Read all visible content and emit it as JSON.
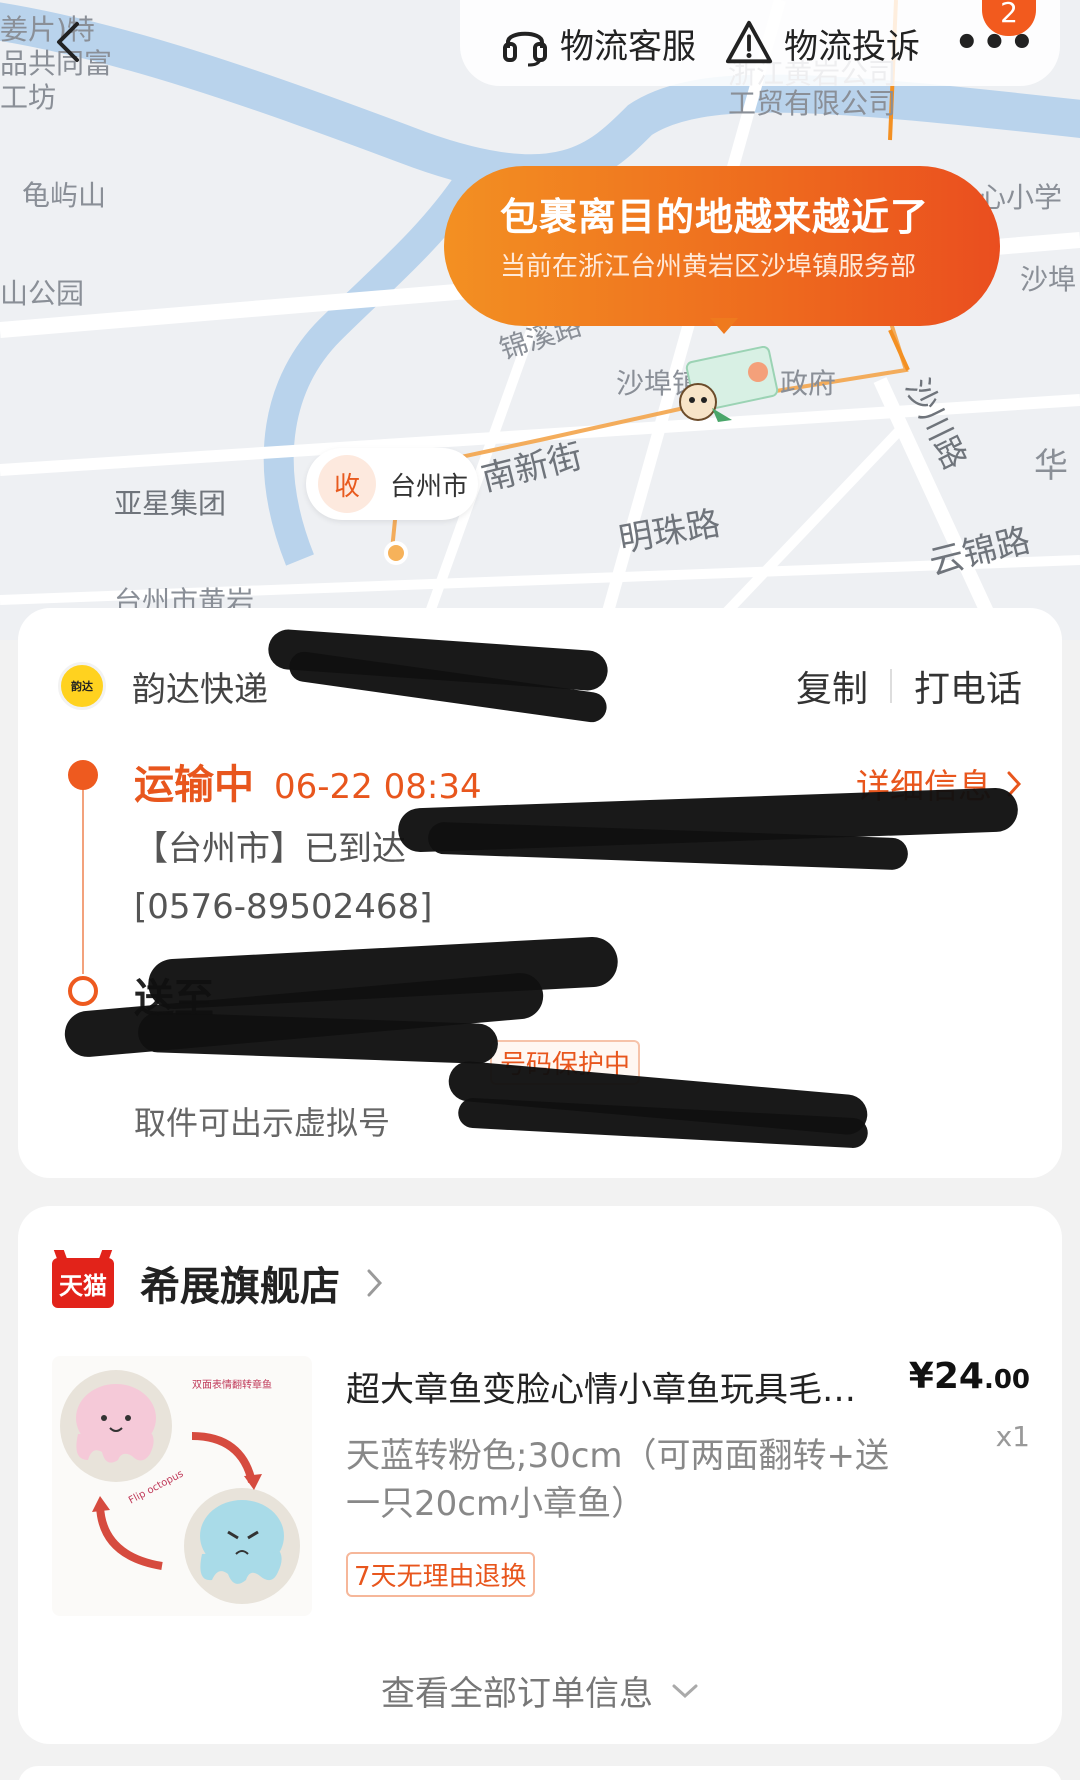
{
  "map": {
    "labels": [
      "姜片)特",
      "品共同富",
      "工坊",
      "龟屿山",
      "山公园",
      "锦溪路",
      "沙埠镇",
      "政府",
      "南新街",
      "明珠路",
      "亚星集团",
      "台州市黄岩",
      "云锦路",
      "沙川路",
      "心小学",
      "沙埠",
      "华",
      "浙江黄岩公司",
      "工贸有限公司"
    ],
    "bubble": {
      "title": "包裹离目的地越来越近了",
      "subtitle": "当前在浙江台州黄岩区沙埠镇服务部"
    },
    "receiver_tag": {
      "icon_text": "收",
      "city": "台州市"
    },
    "route_color": "#f39022"
  },
  "topbar": {
    "back_icon": "chevron-left-icon",
    "service_label": "物流客服",
    "complaint_label": "物流投诉",
    "more_label": "•••",
    "badge_count": "2"
  },
  "logistics": {
    "carrier_logo_text": "韵达",
    "carrier_name": "韵达快递",
    "tracking_number": "",
    "copy_label": "复制",
    "call_label": "打电话",
    "status": "运输中",
    "status_time": "06-22 08:34",
    "detail_label": "详细信息",
    "status_desc_prefix": "【台州市】已到达",
    "status_desc_phone": "[0576-89502468]",
    "deliver_to": "送至",
    "privacy_badge": "号码保护中",
    "pickup_tip": "取件可出示虚拟号"
  },
  "order": {
    "platform_badge": "天猫",
    "shop_name": "希展旗舰店",
    "product_title": "超大章鱼变脸心情小章鱼玩具毛绒公仔",
    "price_symbol": "¥",
    "price_int": "24",
    "price_dec": ".00",
    "quantity": "x1",
    "spec": "天蓝转粉色;30cm（可两面翻转+送一只20cm小章鱼）",
    "return_badge": "7天无理由退换",
    "see_all_label": "查看全部订单信息",
    "img_caption": "双面表情翻转章鱼",
    "img_flip_text": "Flip octopus"
  },
  "colors": {
    "accent": "#e8561d",
    "tmall": "#e2231a"
  }
}
